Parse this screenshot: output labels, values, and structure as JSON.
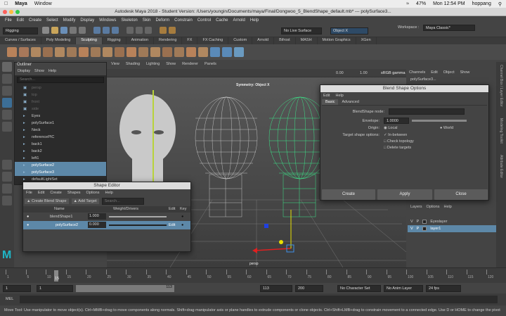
{
  "mac_menu": {
    "app": "Maya",
    "window": "Window",
    "wifi": "47%",
    "clock": "Mon 12:54 PM",
    "user": "hoppang"
  },
  "window_title": "Autodesk Maya 2018 - Student Version: /Users/youngin/Documents/maya/Final/Dongwoo_5_BlendShape_default.mb* --- polySurface3...",
  "main_menu": [
    "File",
    "Edit",
    "Create",
    "Select",
    "Modify",
    "Display",
    "Windows",
    "Skeleton",
    "Skin",
    "Deform",
    "Constrain",
    "Control",
    "Cache",
    "Arnold",
    "Help"
  ],
  "status": {
    "menuset": "Rigging",
    "live_surface": "No Live Surface",
    "object_mode": "Object X",
    "workspace_label": "Workspace :",
    "workspace": "Maya Classic*"
  },
  "shelf_tabs": [
    "Curves / Surfaces",
    "Poly Modeling",
    "Sculpting",
    "Rigging",
    "Animation",
    "Rendering",
    "FX",
    "FX Caching",
    "Custom",
    "Arnold",
    "Bifrost",
    "MASH",
    "Motion Graphics",
    "XGen"
  ],
  "outliner": {
    "title": "Outliner",
    "menu": [
      "Display",
      "Show",
      "Help"
    ],
    "search_placeholder": "Search...",
    "items": [
      {
        "label": "persp",
        "state": "dim"
      },
      {
        "label": "top",
        "state": "dim"
      },
      {
        "label": "front",
        "state": "dim"
      },
      {
        "label": "side",
        "state": "dim"
      },
      {
        "label": "Eyes",
        "state": "normal"
      },
      {
        "label": "polySurface1",
        "state": "normal"
      },
      {
        "label": "Neck",
        "state": "normal"
      },
      {
        "label": "referencePIC",
        "state": "normal"
      },
      {
        "label": "back1",
        "state": "normal"
      },
      {
        "label": "back2",
        "state": "normal"
      },
      {
        "label": "left1",
        "state": "normal"
      },
      {
        "label": "polySurface2",
        "state": "selected"
      },
      {
        "label": "polySurface3",
        "state": "selected"
      },
      {
        "label": "defaultLightSet",
        "state": "normal"
      }
    ]
  },
  "viewport": {
    "menu": [
      "View",
      "Shading",
      "Lighting",
      "Show",
      "Renderer",
      "Panels"
    ],
    "symmetry": "Symmetry: Object X",
    "camera": "persp",
    "exposure": "0.00",
    "gamma": "1.00",
    "colorspace": "sRGB gamma"
  },
  "channel_box": {
    "menu": [
      "Channels",
      "Edit",
      "Object",
      "Show"
    ],
    "object": "polySurface3...",
    "side_tabs": [
      "Channel Box / Layer Editor",
      "Modeling Toolkit",
      "Attribute Editor"
    ]
  },
  "layers": {
    "menu": [
      "Layers",
      "Options",
      "Help"
    ],
    "rows": [
      {
        "v": "V",
        "p": "P",
        "name": "Eyeslayer"
      },
      {
        "v": "V",
        "p": "P",
        "name": "layer1"
      }
    ]
  },
  "blend_dialog": {
    "title": "Blend Shape Options",
    "menu": [
      "Edit",
      "Help"
    ],
    "tabs": [
      "Basic",
      "Advanced"
    ],
    "node_label": "BlendShape node:",
    "envelope_label": "Envelope:",
    "envelope_value": "1.0000",
    "envelope_level": 1.0,
    "origin_label": "Origin:",
    "origin_local": "Local",
    "origin_world": "World",
    "target_label": "Target shape options:",
    "inbetween": "In-between",
    "check_topology": "Check topology",
    "delete_targets": "Delete targets",
    "buttons": [
      "Create",
      "Apply",
      "Close"
    ]
  },
  "shape_editor": {
    "title": "Shape Editor",
    "menu": [
      "File",
      "Edit",
      "Create",
      "Shapes",
      "Options",
      "Help"
    ],
    "create_btn": "Create Blend Shape",
    "add_btn": "Add Target",
    "search_placeholder": "Search...",
    "col_name": "Name",
    "col_weight": "Weight/Drivers",
    "col_edit": "Edit",
    "col_key": "Key",
    "rows": [
      {
        "name": "blendShape1",
        "weight": "1.000",
        "level": 1.0,
        "edit": ""
      },
      {
        "name": "polySurface2",
        "weight": "0.000",
        "level": 0.0,
        "edit": "Edit"
      }
    ]
  },
  "timeline": {
    "ticks": [
      "1",
      "5",
      "10",
      "15",
      "20",
      "25",
      "30",
      "35",
      "40",
      "45",
      "50",
      "55",
      "60",
      "65",
      "70",
      "75",
      "80",
      "85",
      "90",
      "95",
      "100",
      "105",
      "110",
      "115",
      "120"
    ],
    "current": "15"
  },
  "range": {
    "start": "1",
    "start2": "1",
    "cur": "113",
    "end": "113",
    "end2": "200",
    "charset": "No Character Set",
    "animlayer": "No Anim Layer",
    "fps": "24 fps"
  },
  "mel_label": "MEL",
  "help_line": "Move Tool: Use manipulator to move object(s). Ctrl+MMB+drag to move components along normals. Shift+drag manipulator axis or plane handles to extrude components or clone objects. Ctrl+Shift+LMB+drag to constrain movement to a connected edge. Use D or HOME to change the pivot"
}
